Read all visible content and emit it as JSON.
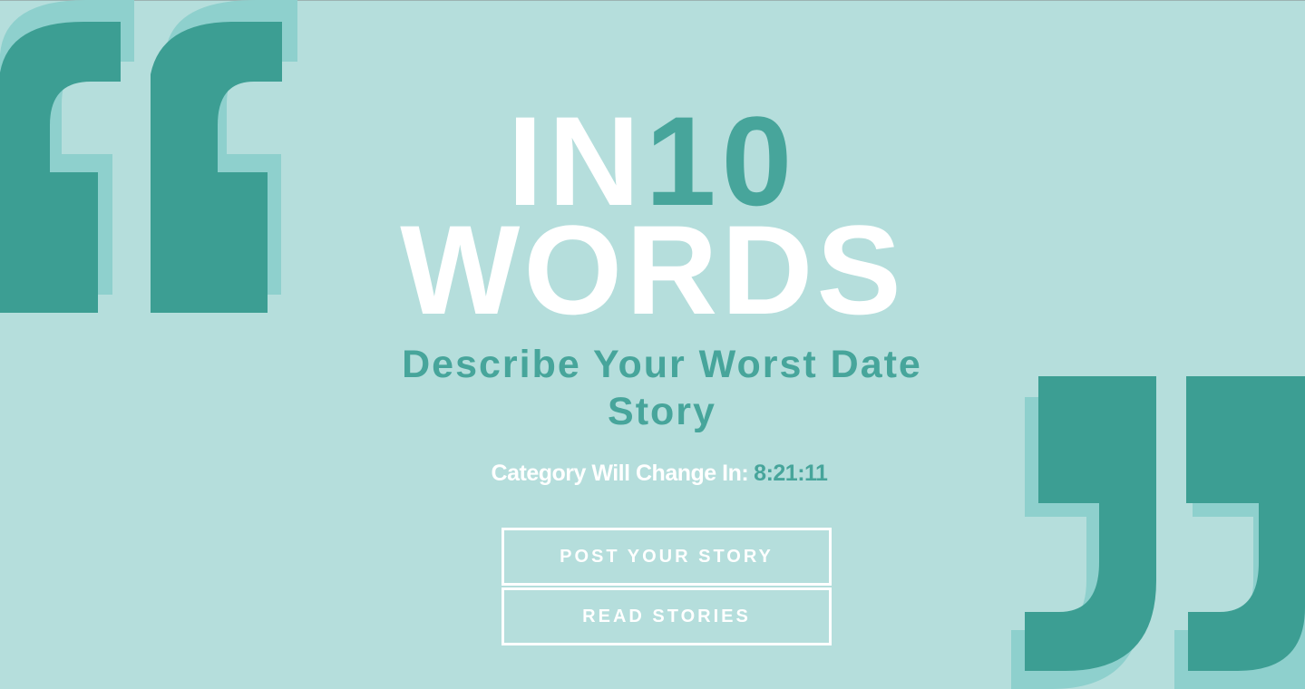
{
  "hero": {
    "title_in": "IN",
    "title_number": "10",
    "title_words": "WORDS",
    "category": "Describe Your Worst Date Story",
    "countdown_label": "Category Will Change In:",
    "countdown_time": "8:21:11"
  },
  "actions": {
    "post_label": "POST YOUR STORY",
    "read_label": "READ STORIES"
  },
  "colors": {
    "background": "#b5dedc",
    "accent": "#47a59b",
    "quote_dark": "#3c9e93",
    "quote_light": "#8ed0cd",
    "text": "#ffffff"
  },
  "icons": {
    "open_quote": "open-quote-icon",
    "close_quote": "close-quote-icon"
  }
}
